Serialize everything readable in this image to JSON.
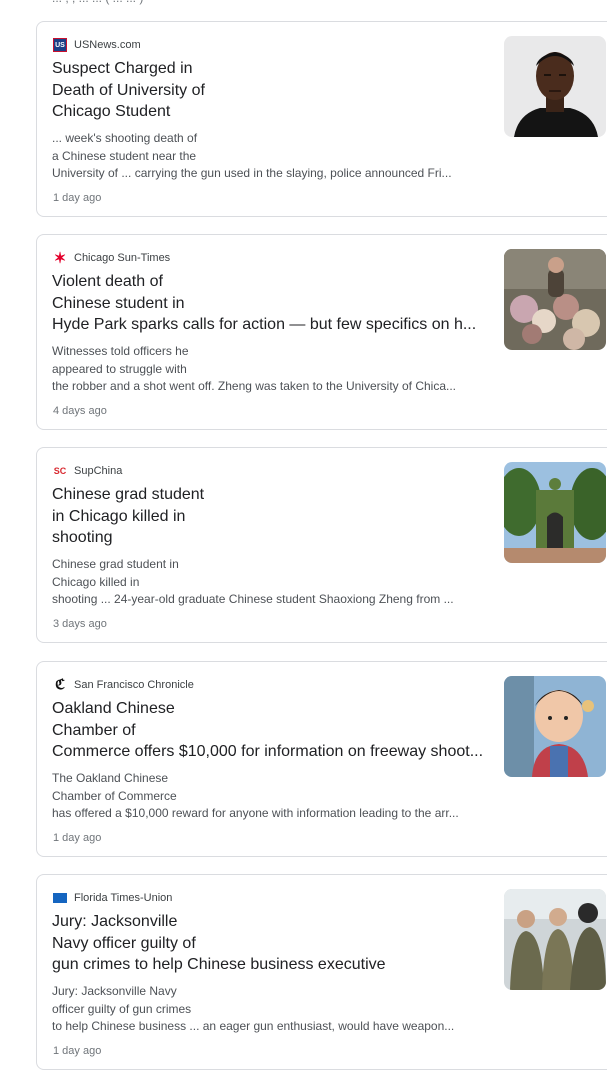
{
  "top_partial_text": "... , , ... ... ( ... ... )",
  "articles": [
    {
      "source": "USNews.com",
      "source_icon": "usnews-logo-icon",
      "title_lines": [
        "Suspect Charged in",
        "Death of University of",
        "Chicago Student"
      ],
      "snippet_lines": [
        "... week's shooting death of",
        "a Chinese student near the",
        "University of ... carrying the gun used in the slaying, police announced Fri..."
      ],
      "age": "1 day ago",
      "thumb": "mugshot-photo"
    },
    {
      "source": "Chicago Sun-Times",
      "source_icon": "chicago-star-logo-icon",
      "title_lines": [
        "Violent death of",
        "Chinese student in",
        "Hyde Park sparks calls for action — but few specifics on h..."
      ],
      "snippet_lines": [
        "Witnesses told officers he",
        "appeared to struggle with",
        "the robber and a shot went off. Zheng was taken to the University of Chica..."
      ],
      "age": "4 days ago",
      "thumb": "memorial-flowers-photo"
    },
    {
      "source": "SupChina",
      "source_icon": "supchina-logo-icon",
      "title_lines": [
        "Chinese grad student",
        "in Chicago killed in",
        "shooting"
      ],
      "snippet_lines": [
        "Chinese grad student in",
        "Chicago killed in",
        "shooting ... 24-year-old graduate Chinese student Shaoxiong Zheng from ..."
      ],
      "age": "3 days ago",
      "thumb": "campus-gate-photo"
    },
    {
      "source": "San Francisco Chronicle",
      "source_icon": "sf-chronicle-logo-icon",
      "title_lines": [
        "Oakland Chinese",
        "Chamber of",
        "Commerce offers $10,000 for information on freeway shoot..."
      ],
      "snippet_lines": [
        "The Oakland Chinese",
        "Chamber of Commerce",
        "has offered a $10,000 reward for anyone with information leading to the arr..."
      ],
      "age": "1 day ago",
      "thumb": "child-photo"
    },
    {
      "source": "Florida Times-Union",
      "source_icon": "times-union-logo-icon",
      "title_lines": [
        "Jury: Jacksonville",
        "Navy officer guilty of",
        "gun crimes to help Chinese business executive"
      ],
      "snippet_lines": [
        "Jury: Jacksonville Navy",
        "officer guilty of gun crimes",
        "to help Chinese business ... an eager gun enthusiast, would have weapon..."
      ],
      "age": "1 day ago",
      "thumb": "navy-officers-photo"
    }
  ]
}
